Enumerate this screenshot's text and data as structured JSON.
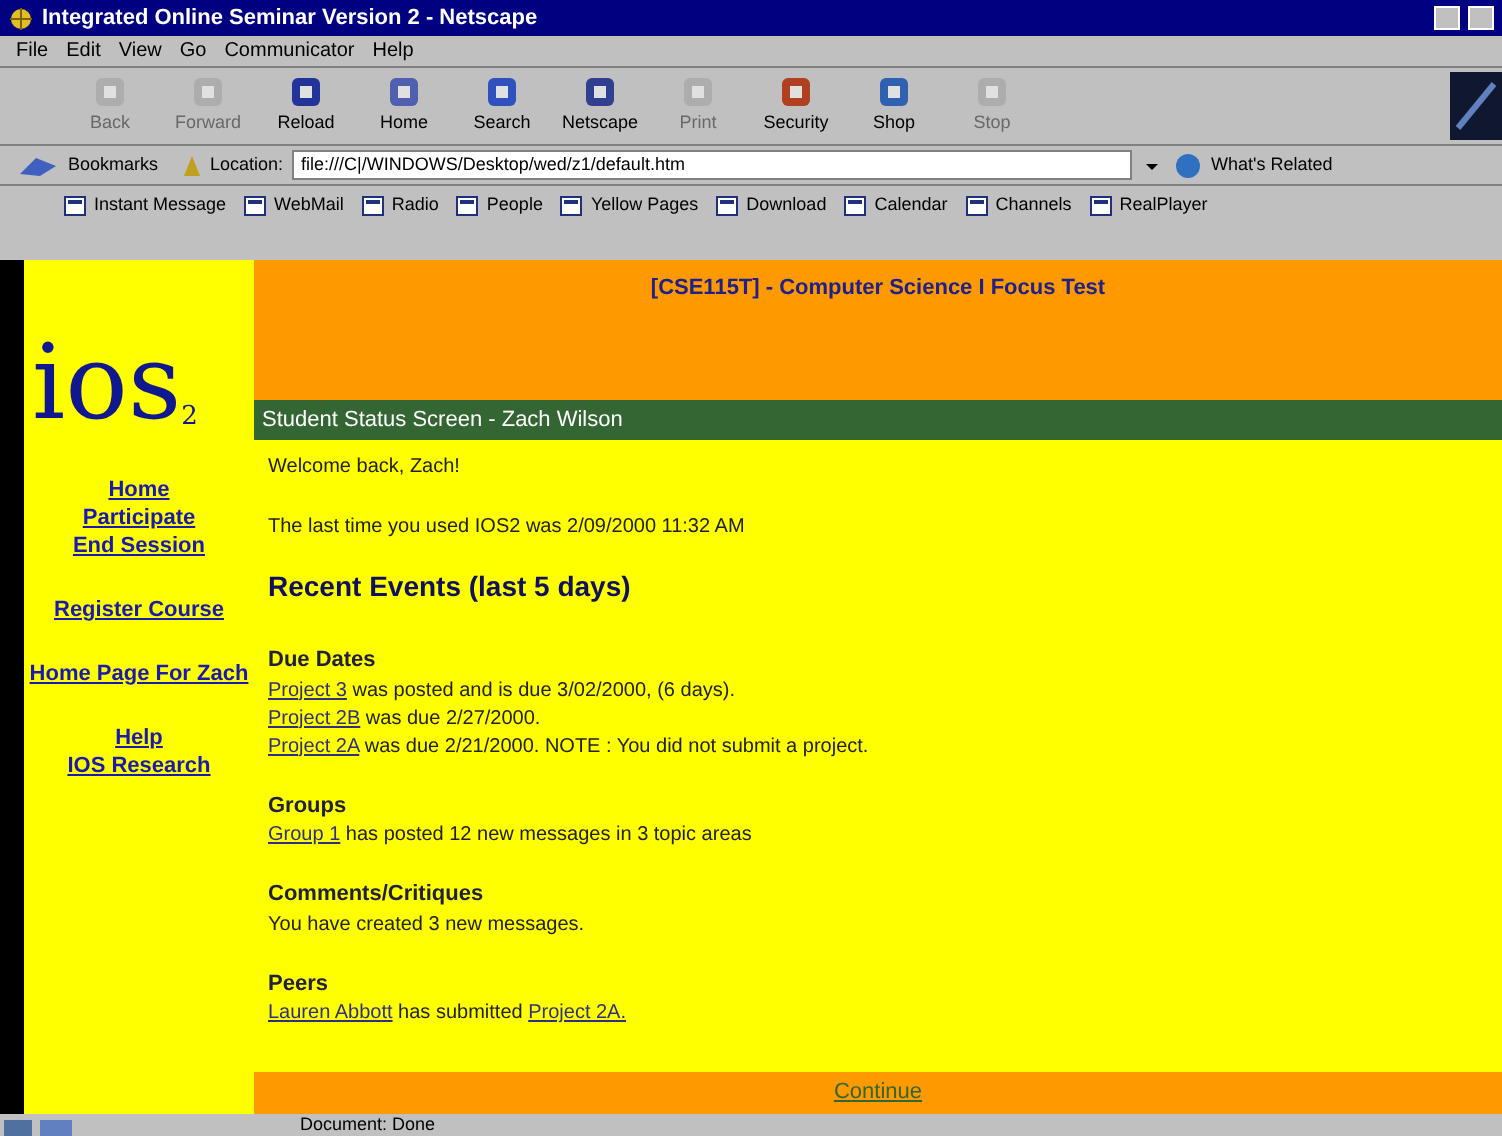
{
  "window": {
    "title": "Integrated Online Seminar Version 2 - Netscape"
  },
  "menu": [
    "File",
    "Edit",
    "View",
    "Go",
    "Communicator",
    "Help"
  ],
  "toolbar": [
    {
      "label": "Back",
      "disabled": true
    },
    {
      "label": "Forward",
      "disabled": true
    },
    {
      "label": "Reload",
      "disabled": false
    },
    {
      "label": "Home",
      "disabled": false
    },
    {
      "label": "Search",
      "disabled": false
    },
    {
      "label": "Netscape",
      "disabled": false
    },
    {
      "label": "Print",
      "disabled": true
    },
    {
      "label": "Security",
      "disabled": false
    },
    {
      "label": "Shop",
      "disabled": false
    },
    {
      "label": "Stop",
      "disabled": true
    }
  ],
  "location_bar": {
    "bookmarks": "Bookmarks",
    "label": "Location:",
    "value": "file:///C|/WINDOWS/Desktop/wed/z1/default.htm",
    "related": "What's Related"
  },
  "personal_bar": [
    "Instant Message",
    "WebMail",
    "Radio",
    "People",
    "Yellow Pages",
    "Download",
    "Calendar",
    "Channels",
    "RealPlayer"
  ],
  "page": {
    "logo": "ios",
    "logo_sub": "2",
    "course": "[CSE115T] - Computer Science I Focus Test",
    "subtitle": "Student Status Screen - Zach Wilson",
    "nav": [
      [
        "Home",
        "Participate",
        "End Session"
      ],
      [
        "Register Course"
      ],
      [
        "Home Page For Zach"
      ],
      [
        "Help",
        "IOS Research"
      ]
    ],
    "welcome": "Welcome back, Zach!",
    "last_used": "The last time you used IOS2 was 2/09/2000 11:32 AM",
    "heading": "Recent Events (last 5 days)",
    "sections": [
      {
        "title": "Due Dates",
        "lines": [
          [
            {
              "kind": "link",
              "text": "Project 3"
            },
            {
              "kind": "text",
              "text": " was posted and is due 3/02/2000, (6 days)."
            }
          ],
          [
            {
              "kind": "link",
              "text": "Project 2B"
            },
            {
              "kind": "text",
              "text": " was due 2/27/2000."
            }
          ],
          [
            {
              "kind": "link",
              "text": "Project 2A"
            },
            {
              "kind": "text",
              "text": " was due 2/21/2000. NOTE : You did not submit a project."
            }
          ]
        ]
      },
      {
        "title": "Groups",
        "lines": [
          [
            {
              "kind": "link",
              "text": "Group 1"
            },
            {
              "kind": "text",
              "text": " has posted 12 new messages in 3 topic areas"
            }
          ]
        ]
      },
      {
        "title": "Comments/Critiques",
        "lines": [
          [
            {
              "kind": "text",
              "text": "You have created 3 new messages."
            }
          ]
        ]
      },
      {
        "title": "Peers",
        "lines": [
          [
            {
              "kind": "link",
              "text": "Lauren Abbott"
            },
            {
              "kind": "text",
              "text": " has submitted "
            },
            {
              "kind": "link",
              "text": "Project 2A."
            }
          ]
        ]
      }
    ],
    "continue": "Continue"
  },
  "status_bar": {
    "text": "Document: Done"
  }
}
